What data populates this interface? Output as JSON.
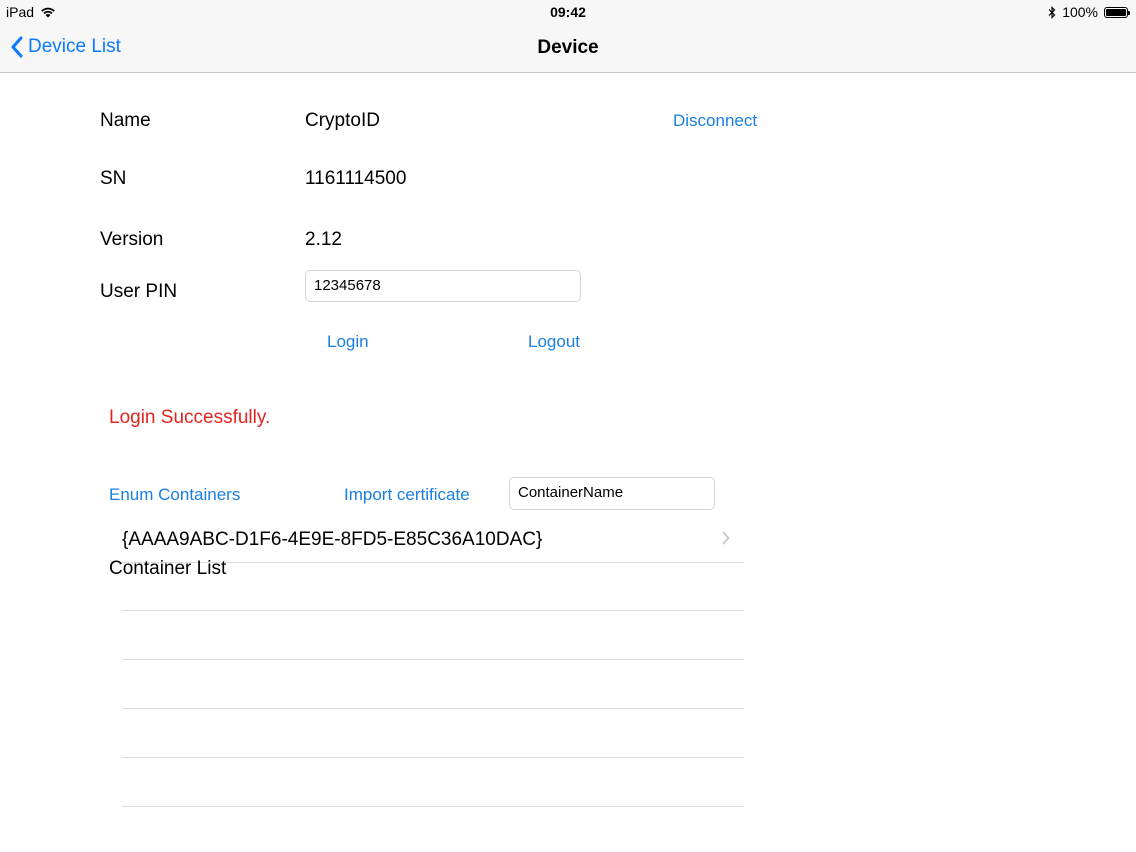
{
  "status_bar": {
    "device": "iPad",
    "time": "09:42",
    "battery": "100%"
  },
  "nav": {
    "back_label": "Device List",
    "title": "Device"
  },
  "device": {
    "name_label": "Name",
    "name_value": "CryptoID",
    "disconnect_label": "Disconnect",
    "sn_label": "SN",
    "sn_value": "1161114500",
    "version_label": "Version",
    "version_value": "2.12",
    "pin_label": "User PIN",
    "pin_value": "12345678",
    "login_label": "Login",
    "logout_label": "Logout"
  },
  "status_message": "Login Successfully.",
  "containers": {
    "enum_label": "Enum Containers",
    "import_label": "Import certificate",
    "container_name_value": "ContainerName",
    "list_label": "Container List",
    "items": [
      {
        "label": "{AAAA9ABC-D1F6-4E9E-8FD5-E85C36A10DAC}"
      }
    ]
  },
  "colors": {
    "link": "#1a7fe0",
    "status_error": "#e3251f"
  }
}
